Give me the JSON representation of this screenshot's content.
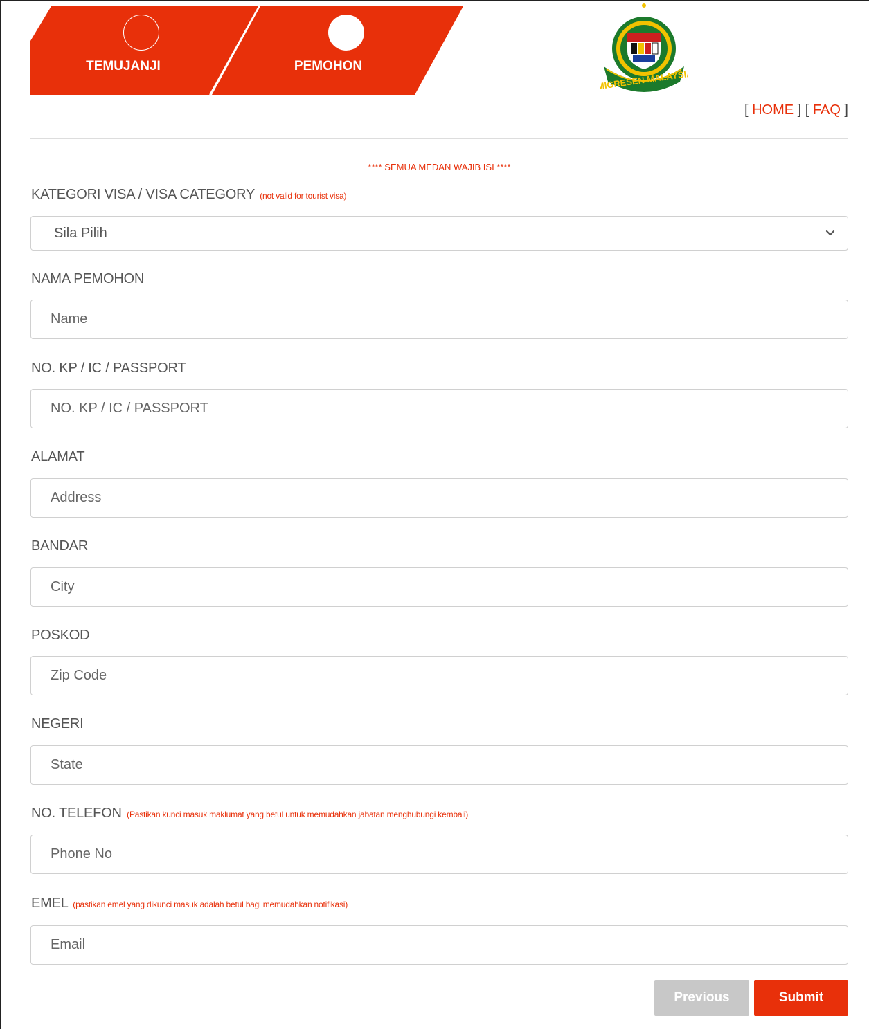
{
  "steps": [
    {
      "label": "TEMUJANJI",
      "state": "open"
    },
    {
      "label": "PEMOHON",
      "state": "filled"
    }
  ],
  "logo": {
    "icon": "imigresen-malaysia-crest",
    "text": "IMIGRESEN MALAYSIA"
  },
  "links": {
    "open1": "[ ",
    "home": "HOME",
    "mid": " ] [ ",
    "faq": "FAQ",
    "close": " ]"
  },
  "required_note": "**** SEMUA MEDAN WAJIB ISI ****",
  "form": {
    "visa": {
      "label": "KATEGORI VISA / VISA CATEGORY",
      "hint": "(not valid for tourist visa)",
      "value": "Sila Pilih",
      "icon": "chevron-down-icon"
    },
    "name": {
      "label": "NAMA PEMOHON",
      "placeholder": "Name"
    },
    "ic": {
      "label": "NO. KP / IC / PASSPORT",
      "placeholder": "NO. KP / IC / PASSPORT"
    },
    "address": {
      "label": "ALAMAT",
      "placeholder": "Address"
    },
    "city": {
      "label": "BANDAR",
      "placeholder": "City"
    },
    "zip": {
      "label": "POSKOD",
      "placeholder": "Zip Code"
    },
    "state": {
      "label": "NEGERI",
      "placeholder": "State"
    },
    "phone": {
      "label": "NO. TELEFON",
      "hint": "(Pastikan kunci masuk maklumat yang betul untuk memudahkan jabatan menghubungi kembali)",
      "placeholder": "Phone No"
    },
    "email": {
      "label": "EMEL",
      "hint": "(pastikan emel yang dikunci masuk adalah betul bagi memudahkan notifikasi)",
      "placeholder": "Email"
    }
  },
  "buttons": {
    "previous": "Previous",
    "submit": "Submit"
  },
  "colors": {
    "accent": "#e8300a",
    "disabled": "#c8c8c8",
    "text": "#555555"
  }
}
